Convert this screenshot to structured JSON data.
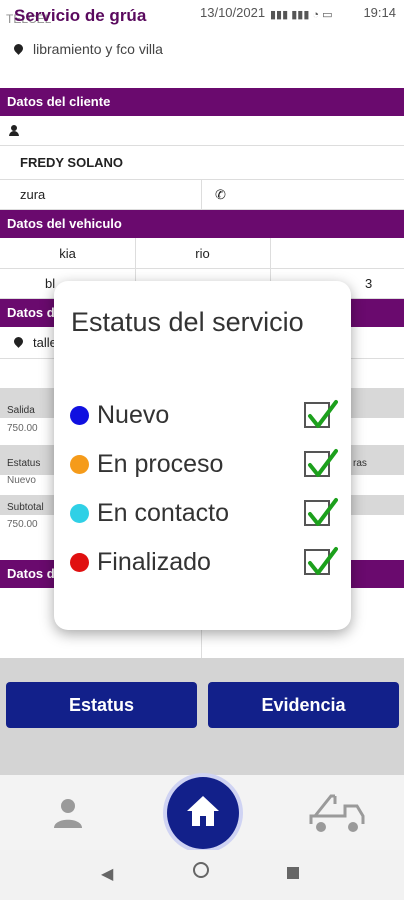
{
  "app": {
    "title": "Servicio de grúa"
  },
  "status_bar": {
    "carrier": "TELCEL",
    "date": "13/10/2021",
    "time": "19:14"
  },
  "location": {
    "text": "libramiento y fco villa"
  },
  "sections": {
    "client": "Datos del cliente",
    "vehicle": "Datos del vehiculo",
    "service": "Datos d",
    "other": "Datos d"
  },
  "client": {
    "name": "FREDY SOLANO",
    "colonia": "zura"
  },
  "vehicle": {
    "brand": "kia",
    "model": "rio",
    "plate_fragment": "bl",
    "year_fragment": "3"
  },
  "service_place": {
    "text": "talle"
  },
  "summary": {
    "salida_label": "Salida",
    "salida_value": "750.00",
    "estatus_label": "Estatus",
    "estatus_value": "Nuevo",
    "subtotal_label": "Subtotal",
    "subtotal_value": "750.00",
    "right_label": "ras"
  },
  "dialog": {
    "title": "Estatus del servicio",
    "options": [
      {
        "label": "Nuevo",
        "color": "#1010e0",
        "checked": true
      },
      {
        "label": "En proceso",
        "color": "#f59b1a",
        "checked": true
      },
      {
        "label": "En contacto",
        "color": "#2fd0e6",
        "checked": true
      },
      {
        "label": "Finalizado",
        "color": "#e01010",
        "checked": true
      }
    ]
  },
  "buttons": {
    "estatus": "Estatus",
    "evidencia": "Evidencia"
  },
  "nav": {
    "profile": "profile-icon",
    "home": "home-icon",
    "tow": "tow-truck-icon"
  },
  "colors": {
    "section": "#6a0a6e",
    "button": "#12208a",
    "check": "#1ca01c"
  }
}
